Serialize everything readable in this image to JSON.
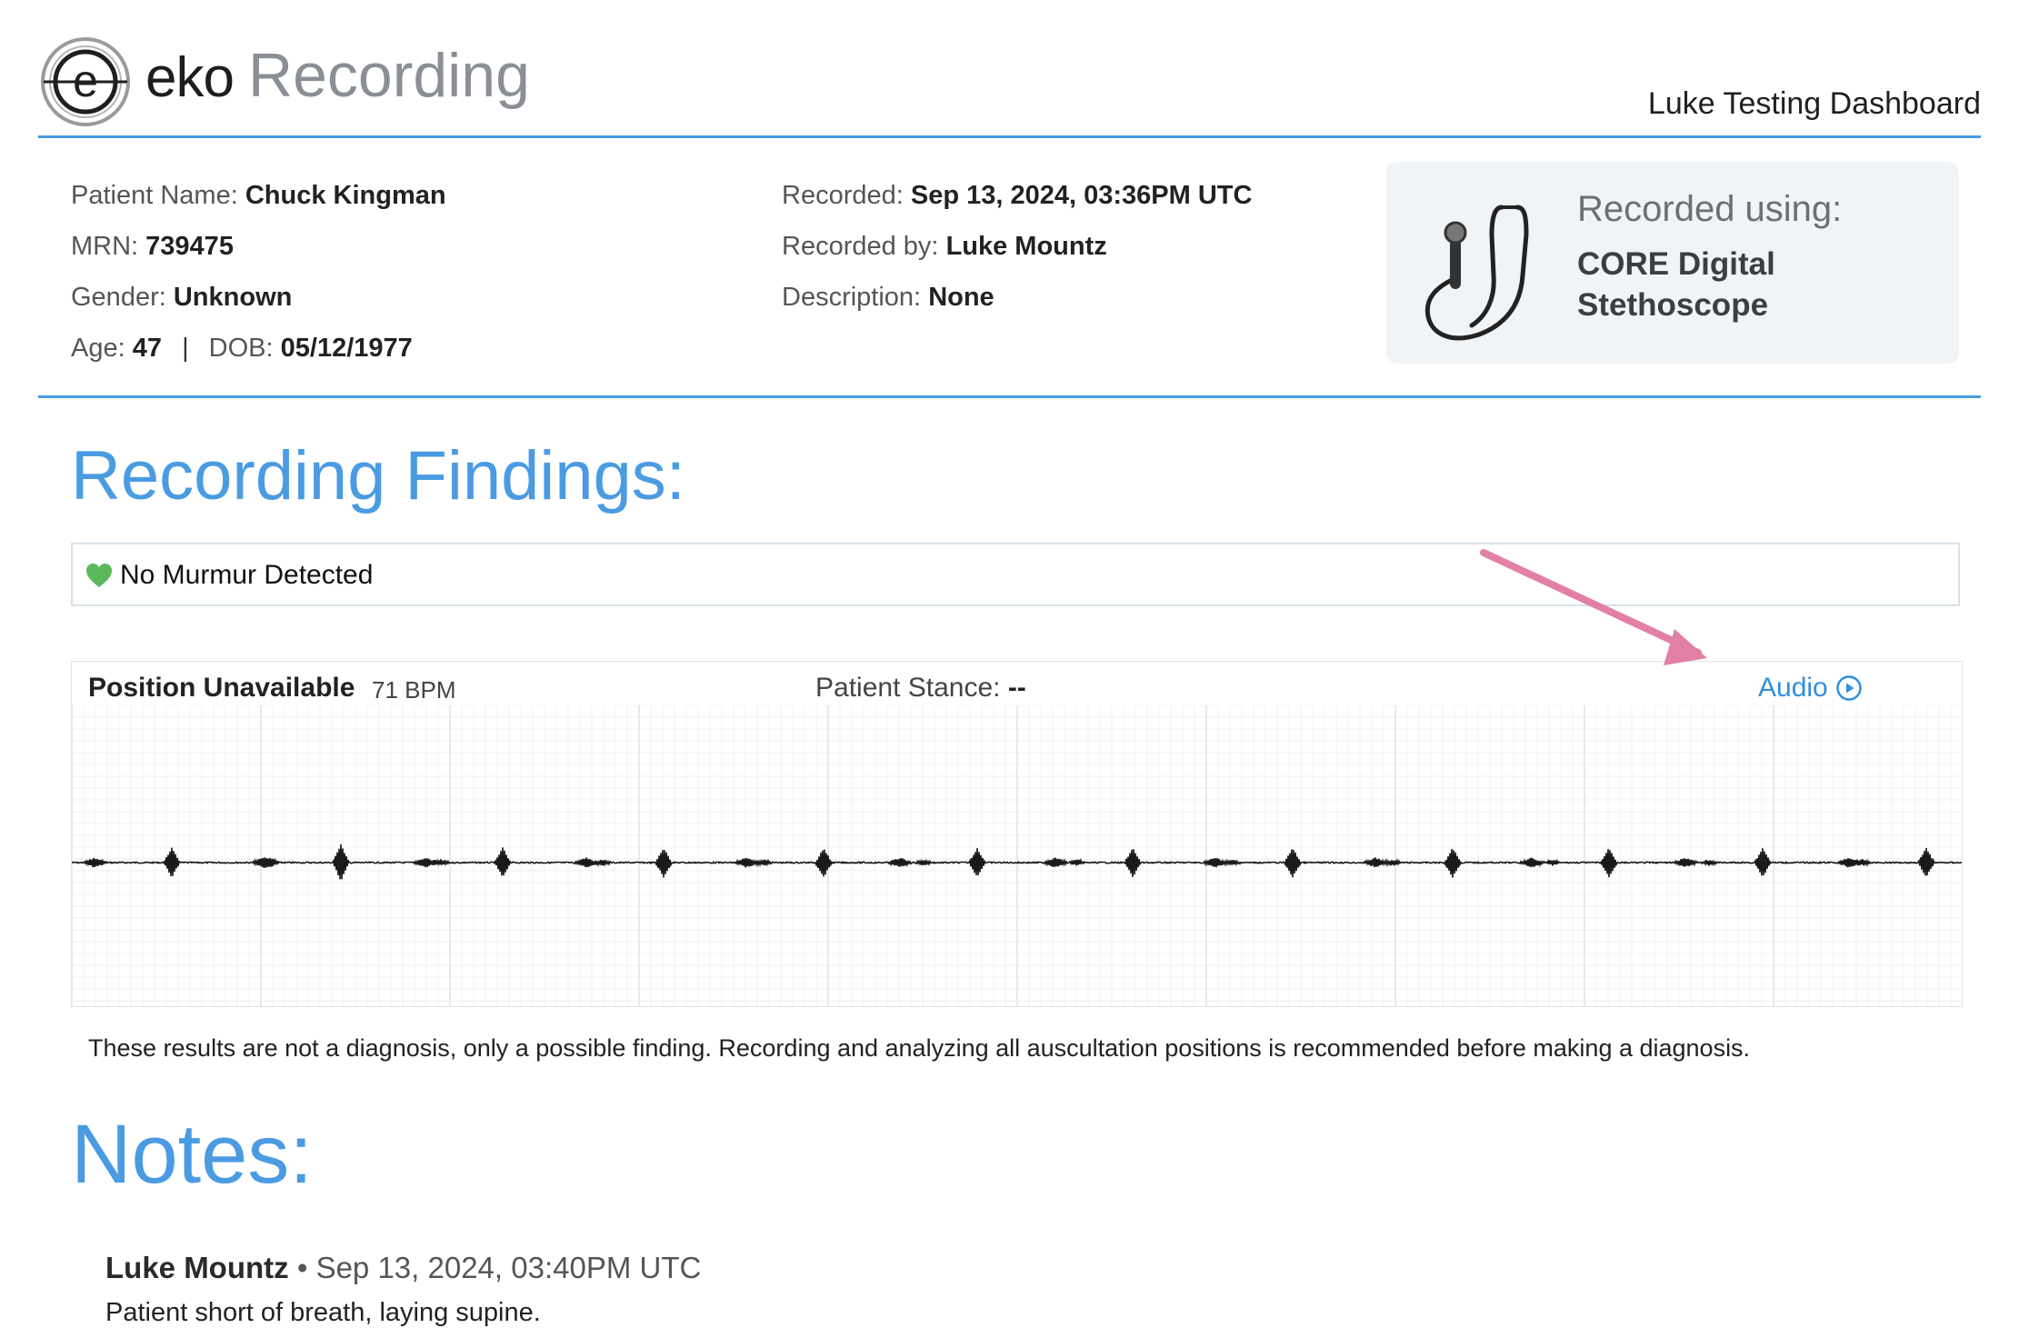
{
  "header": {
    "brand_name": "eko",
    "brand_product": "Recording",
    "dashboard_name": "Luke Testing Dashboard"
  },
  "patient": {
    "name_label": "Patient Name:",
    "name": "Chuck Kingman",
    "mrn_label": "MRN:",
    "mrn": "739475",
    "gender_label": "Gender:",
    "gender": "Unknown",
    "age_label": "Age:",
    "age": "47",
    "separator": "|",
    "dob_label": "DOB:",
    "dob": "05/12/1977"
  },
  "recording": {
    "recorded_label": "Recorded:",
    "recorded": "Sep 13, 2024, 03:36PM UTC",
    "recorded_by_label": "Recorded by:",
    "recorded_by": "Luke Mountz",
    "description_label": "Description:",
    "description": "None"
  },
  "device": {
    "heading": "Recorded using:",
    "name_line1": "CORE Digital",
    "name_line2": "Stethoscope",
    "icon": "stethoscope-icon"
  },
  "findings": {
    "title": "Recording Findings:",
    "result": "No Murmur Detected",
    "result_icon": "green-heart-icon",
    "result_color": "#5cb85c"
  },
  "waveform_panel": {
    "position": "Position Unavailable",
    "bpm": "71 BPM",
    "stance_label": "Patient Stance:",
    "stance_value": "--",
    "audio_label": "Audio",
    "audio_icon": "play-circle-icon"
  },
  "disclaimer": "These results are not a diagnosis, only a possible finding. Recording and analyzing all auscultation positions is recommended before making a diagnosis.",
  "notes": {
    "title": "Notes:",
    "items": [
      {
        "author": "Luke Mountz",
        "bullet": "•",
        "date": "Sep 13, 2024, 03:40PM UTC",
        "text": "Patient short of breath, laying supine."
      }
    ]
  },
  "colors": {
    "accent": "#4a9be2",
    "annotation_arrow": "#e27fa6"
  }
}
